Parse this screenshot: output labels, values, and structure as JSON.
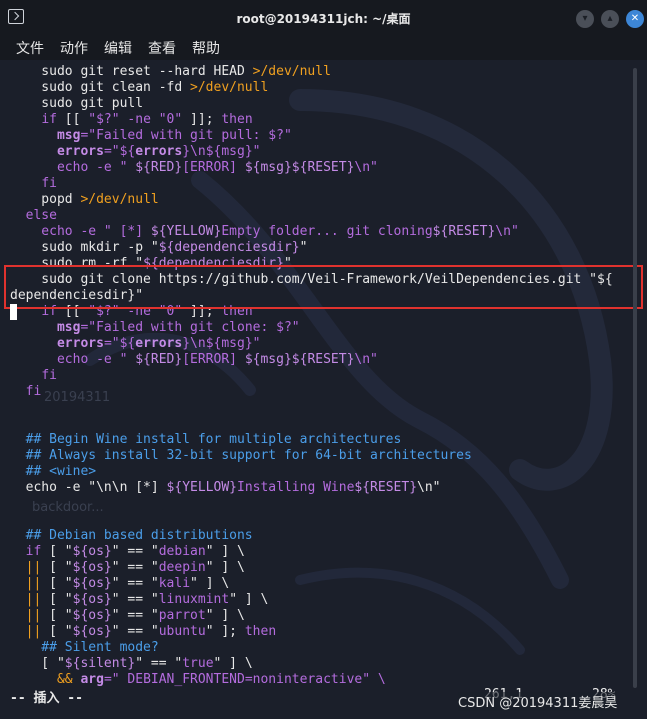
{
  "window": {
    "title": "root@20194311jch: ~/桌面"
  },
  "menu": [
    "文件",
    "动作",
    "编辑",
    "查看",
    "帮助"
  ],
  "code_lines": [
    [
      [
        "    sudo git reset --hard HEAD ",
        "cmd"
      ],
      [
        ">/dev/null",
        "redir"
      ]
    ],
    [
      [
        "    sudo git clean -fd ",
        "cmd"
      ],
      [
        ">/dev/null",
        "redir"
      ]
    ],
    [
      [
        "    sudo git pull",
        "cmd"
      ]
    ],
    [
      [
        "    ",
        "cmd"
      ],
      [
        "if",
        "kw"
      ],
      [
        " [[ ",
        "cmd"
      ],
      [
        "\"$?\"",
        "str"
      ],
      [
        " -ne ",
        "str"
      ],
      [
        "\"0\"",
        "str"
      ],
      [
        " ]]; ",
        "cmd"
      ],
      [
        "then",
        "kw"
      ]
    ],
    [
      [
        "      ",
        "cmd"
      ],
      [
        "msg",
        "varname"
      ],
      [
        "=\"Failed with git pull: $?\"",
        "str"
      ]
    ],
    [
      [
        "      ",
        "cmd"
      ],
      [
        "errors",
        "varname"
      ],
      [
        "=\"${",
        "str"
      ],
      [
        "errors",
        "varname"
      ],
      [
        "}\\n${msg}\"",
        "str"
      ]
    ],
    [
      [
        "      echo -e \" ",
        "str"
      ],
      [
        "${RED}",
        "var"
      ],
      [
        "[ERROR] ",
        "str"
      ],
      [
        "${msg}${RESET}",
        "var"
      ],
      [
        "\\n\"",
        "str"
      ]
    ],
    [
      [
        "    ",
        "cmd"
      ],
      [
        "fi",
        "kw"
      ]
    ],
    [
      [
        "    popd ",
        "cmd"
      ],
      [
        ">/dev/null",
        "redir"
      ]
    ],
    [
      [
        "  ",
        "cmd"
      ],
      [
        "else",
        "kw"
      ]
    ],
    [
      [
        "    echo -e \" ",
        "str"
      ],
      [
        "[*] ",
        "str"
      ],
      [
        "${YELLOW}",
        "var"
      ],
      [
        "Empty folder... git cloning",
        "str"
      ],
      [
        "${RESET}",
        "var"
      ],
      [
        "\\n\"",
        "str"
      ]
    ],
    [
      [
        "    sudo mkdir -p \"",
        "cmd"
      ],
      [
        "${dependenciesdir}",
        "var"
      ],
      [
        "\"",
        "cmd"
      ]
    ],
    [
      [
        "    sudo rm -rf \"",
        "cmd"
      ],
      [
        "${dependenciesdir}",
        "var"
      ],
      [
        "\"",
        "cmd"
      ]
    ],
    [
      [
        "    sudo git clone https://github.com/Veil-Framework/VeilDependencies.git \"${",
        "cmd"
      ]
    ],
    [
      [
        "dependenciesdir",
        "cmd"
      ],
      [
        "}\"",
        "cmd"
      ]
    ],
    [
      [
        "    ",
        "cmd"
      ],
      [
        "if",
        "kw"
      ],
      [
        " [[ ",
        "cmd"
      ],
      [
        "\"$?\"",
        "str"
      ],
      [
        " -ne ",
        "str"
      ],
      [
        "\"0\"",
        "str"
      ],
      [
        " ]]; ",
        "cmd"
      ],
      [
        "then",
        "kw"
      ]
    ],
    [
      [
        "      ",
        "cmd"
      ],
      [
        "msg",
        "varname"
      ],
      [
        "=\"Failed with git clone: $?\"",
        "str"
      ]
    ],
    [
      [
        "      ",
        "cmd"
      ],
      [
        "errors",
        "varname"
      ],
      [
        "=\"${",
        "str"
      ],
      [
        "errors",
        "varname"
      ],
      [
        "}\\n${msg}\"",
        "str"
      ]
    ],
    [
      [
        "      echo -e \" ",
        "str"
      ],
      [
        "${RED}",
        "var"
      ],
      [
        "[ERROR] ",
        "str"
      ],
      [
        "${msg}${RESET}",
        "var"
      ],
      [
        "\\n\"",
        "str"
      ]
    ],
    [
      [
        "    ",
        "cmd"
      ],
      [
        "fi",
        "kw"
      ]
    ],
    [
      [
        "  ",
        "cmd"
      ],
      [
        "fi",
        "kw"
      ]
    ],
    [
      [
        "",
        "cmd"
      ]
    ],
    [
      [
        "",
        "cmd"
      ]
    ],
    [
      [
        "  ## Begin Wine install for multiple architectures",
        "comment"
      ]
    ],
    [
      [
        "  ## Always install 32-bit support for 64-bit architectures",
        "comment"
      ]
    ],
    [
      [
        "  ## <wine>",
        "comment"
      ]
    ],
    [
      [
        "  echo -e \"\\n\\n [*] ",
        "cmd"
      ],
      [
        "${YELLOW}",
        "var"
      ],
      [
        "Installing Wine",
        "str"
      ],
      [
        "${RESET}",
        "var"
      ],
      [
        "\\n\"",
        "cmd"
      ]
    ],
    [
      [
        "",
        "cmd"
      ]
    ],
    [
      [
        "",
        "cmd"
      ]
    ],
    [
      [
        "  ## Debian based distributions",
        "comment"
      ]
    ],
    [
      [
        "  ",
        "cmd"
      ],
      [
        "if",
        "kw"
      ],
      [
        " [ \"",
        "cmd"
      ],
      [
        "${os}",
        "var"
      ],
      [
        "\" == \"",
        "cmd"
      ],
      [
        "debian",
        "str"
      ],
      [
        "\" ] \\",
        "cmd"
      ]
    ],
    [
      [
        "  ",
        "cmd"
      ],
      [
        "||",
        "op"
      ],
      [
        " [ \"",
        "cmd"
      ],
      [
        "${os}",
        "var"
      ],
      [
        "\" == \"",
        "cmd"
      ],
      [
        "deepin",
        "str"
      ],
      [
        "\" ] \\",
        "cmd"
      ]
    ],
    [
      [
        "  ",
        "cmd"
      ],
      [
        "||",
        "op"
      ],
      [
        " [ \"",
        "cmd"
      ],
      [
        "${os}",
        "var"
      ],
      [
        "\" == \"",
        "cmd"
      ],
      [
        "kali",
        "str"
      ],
      [
        "\" ] \\",
        "cmd"
      ]
    ],
    [
      [
        "  ",
        "cmd"
      ],
      [
        "||",
        "op"
      ],
      [
        " [ \"",
        "cmd"
      ],
      [
        "${os}",
        "var"
      ],
      [
        "\" == \"",
        "cmd"
      ],
      [
        "linuxmint",
        "str"
      ],
      [
        "\" ] \\",
        "cmd"
      ]
    ],
    [
      [
        "  ",
        "cmd"
      ],
      [
        "||",
        "op"
      ],
      [
        " [ \"",
        "cmd"
      ],
      [
        "${os}",
        "var"
      ],
      [
        "\" == \"",
        "cmd"
      ],
      [
        "parrot",
        "str"
      ],
      [
        "\" ] \\",
        "cmd"
      ]
    ],
    [
      [
        "  ",
        "cmd"
      ],
      [
        "||",
        "op"
      ],
      [
        " [ \"",
        "cmd"
      ],
      [
        "${os}",
        "var"
      ],
      [
        "\" == \"",
        "cmd"
      ],
      [
        "ubuntu",
        "str"
      ],
      [
        "\" ]; ",
        "cmd"
      ],
      [
        "then",
        "kw"
      ]
    ],
    [
      [
        "    ## Silent mode?",
        "comment"
      ]
    ],
    [
      [
        "    [ \"",
        "cmd"
      ],
      [
        "${silent}",
        "var"
      ],
      [
        "\" == \"",
        "cmd"
      ],
      [
        "true",
        "str"
      ],
      [
        "\" ] \\",
        "cmd"
      ]
    ],
    [
      [
        "      ",
        "cmd"
      ],
      [
        "&&",
        "op"
      ],
      [
        " ",
        "cmd"
      ],
      [
        "arg",
        "varname"
      ],
      [
        "=\" DEBIAN_FRONTEND=noninteractive\" \\",
        "str"
      ]
    ]
  ],
  "watermarks": [
    "20194311",
    "backdoor..."
  ],
  "status": {
    "mode": "-- 插入 --",
    "position": "261,1",
    "percent": "28%"
  },
  "csdn": "CSDN @20194311姜晨昊"
}
